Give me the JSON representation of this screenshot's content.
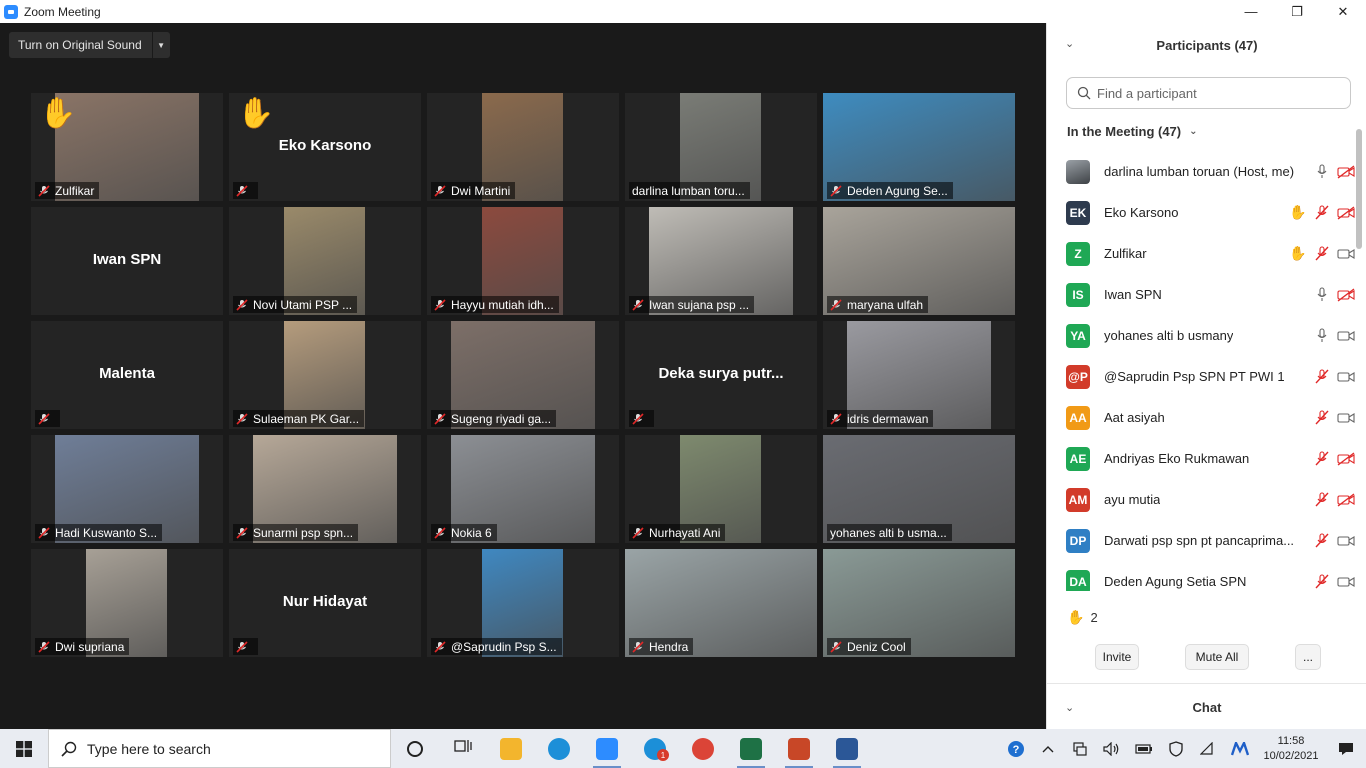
{
  "window": {
    "title": "Zoom Meeting",
    "minimize": "—",
    "maximize": "❐",
    "close": "✕"
  },
  "toolbar": {
    "original_sound_label": "Turn on Original Sound"
  },
  "grid": {
    "rows": [
      [
        {
          "caption": "Zulfikar",
          "video": true,
          "bg": "#8a7466",
          "hand": true
        },
        {
          "caption": "",
          "name": "Eko Karsono",
          "video": false,
          "hand": true
        },
        {
          "caption": "Dwi Martini",
          "video": true,
          "bg": "#8b6a4c"
        },
        {
          "caption": "darlina lumban toru...",
          "video": true,
          "bg": "#7a7c76",
          "nomute": true
        },
        {
          "caption": "Deden Agung Se...",
          "video": true,
          "bg": "#3e8cc0"
        }
      ],
      [
        {
          "caption": "",
          "name": "Iwan SPN",
          "video": false,
          "nomute": true
        },
        {
          "caption": "Novi Utami PSP ...",
          "video": true,
          "bg": "#9a8a6a"
        },
        {
          "caption": "Hayyu mutiah idh...",
          "video": true,
          "bg": "#8c4a3e"
        },
        {
          "caption": "Iwan sujana psp ...",
          "video": true,
          "bg": "#bfbcb6"
        },
        {
          "caption": "maryana ulfah",
          "video": true,
          "bg": "#a9a49b"
        }
      ],
      [
        {
          "caption": "",
          "name": "Malenta",
          "video": false
        },
        {
          "caption": "Sulaeman PK Gar...",
          "video": true,
          "bg": "#b59c7d"
        },
        {
          "caption": "Sugeng riyadi ga...",
          "video": true,
          "bg": "#7d6f68"
        },
        {
          "caption": "",
          "name": "Deka surya putr...",
          "video": false
        },
        {
          "caption": "idris dermawan",
          "video": true,
          "bg": "#9a9aa0"
        }
      ],
      [
        {
          "caption": "Hadi Kuswanto S...",
          "video": true,
          "bg": "#6f7e98"
        },
        {
          "caption": "Sunarmi psp spn...",
          "video": true,
          "bg": "#b6a898"
        },
        {
          "caption": "Nokia 6",
          "video": true,
          "bg": "#8c8f94"
        },
        {
          "caption": "Nurhayati Ani",
          "video": true,
          "bg": "#7e8a6e"
        },
        {
          "caption": "yohanes alti b usma...",
          "video": true,
          "bg": "#6a6c72",
          "active": true,
          "nomute": true
        }
      ],
      [
        {
          "caption": "Dwi supriana",
          "video": true,
          "bg": "#a7a096"
        },
        {
          "caption": "",
          "name": "Nur Hidayat",
          "video": false
        },
        {
          "caption": "@Saprudin Psp S...",
          "video": true,
          "bg": "#3f88c1"
        },
        {
          "caption": "Hendra",
          "video": true,
          "bg": "#9aa4a6"
        },
        {
          "caption": "Deniz Cool",
          "video": true,
          "bg": "#8a9a96"
        }
      ]
    ]
  },
  "panel": {
    "title": "Participants (47)",
    "search_placeholder": "Find a participant",
    "section_label": "In the Meeting (47)",
    "participants": [
      {
        "initials": "",
        "name": "darlina lumban toruan (Host, me)",
        "color": "#6b6e72",
        "photo": true,
        "hand": false,
        "mic": "on",
        "cam": "off"
      },
      {
        "initials": "EK",
        "name": "Eko Karsono",
        "color": "#2e3b4e",
        "hand": true,
        "mic": "muted",
        "cam": "off"
      },
      {
        "initials": "Z",
        "name": "Zulfikar",
        "color": "#1fa855",
        "hand": true,
        "mic": "muted",
        "cam": "on"
      },
      {
        "initials": "IS",
        "name": "Iwan SPN",
        "color": "#1fa855",
        "hand": false,
        "mic": "on",
        "cam": "off"
      },
      {
        "initials": "YA",
        "name": "yohanes alti b usmany",
        "color": "#1fa855",
        "hand": false,
        "mic": "on",
        "cam": "on"
      },
      {
        "initials": "@P",
        "name": "@Saprudin Psp SPN PT PWI 1",
        "color": "#d23b2a",
        "hand": false,
        "mic": "muted",
        "cam": "on"
      },
      {
        "initials": "AA",
        "name": "Aat asiyah",
        "color": "#f19a16",
        "hand": false,
        "mic": "muted",
        "cam": "on"
      },
      {
        "initials": "AE",
        "name": "Andriyas Eko Rukmawan",
        "color": "#1fa855",
        "hand": false,
        "mic": "muted",
        "cam": "off"
      },
      {
        "initials": "AM",
        "name": "ayu mutia",
        "color": "#d23b2a",
        "hand": false,
        "mic": "muted",
        "cam": "off"
      },
      {
        "initials": "DP",
        "name": "Darwati psp spn pt pancaprima...",
        "color": "#2f7fc4",
        "hand": false,
        "mic": "muted",
        "cam": "on"
      },
      {
        "initials": "DA",
        "name": "Deden Agung Setia SPN",
        "color": "#1fa855",
        "hand": false,
        "mic": "muted",
        "cam": "on"
      }
    ],
    "raised_hands_count": "2",
    "invite_label": "Invite",
    "mute_all_label": "Mute All",
    "more_label": "...",
    "chat_title": "Chat"
  },
  "taskbar": {
    "search_placeholder": "Type here to search",
    "apps": [
      {
        "name": "task-view",
        "color": "#222"
      },
      {
        "name": "file-explorer",
        "color": "#f3b52d"
      },
      {
        "name": "edge",
        "color": "#1d8fd8"
      },
      {
        "name": "zoom",
        "color": "#2d8cff",
        "open": true
      },
      {
        "name": "skype",
        "color": "#1c8fd8",
        "badge": "1"
      },
      {
        "name": "chrome",
        "color": "#db4437"
      },
      {
        "name": "excel",
        "color": "#1e7145",
        "open": true
      },
      {
        "name": "powerpoint",
        "color": "#c84727",
        "open": true
      },
      {
        "name": "word",
        "color": "#2b5797",
        "open": true
      }
    ],
    "time": "11:58",
    "date": "10/02/2021"
  }
}
